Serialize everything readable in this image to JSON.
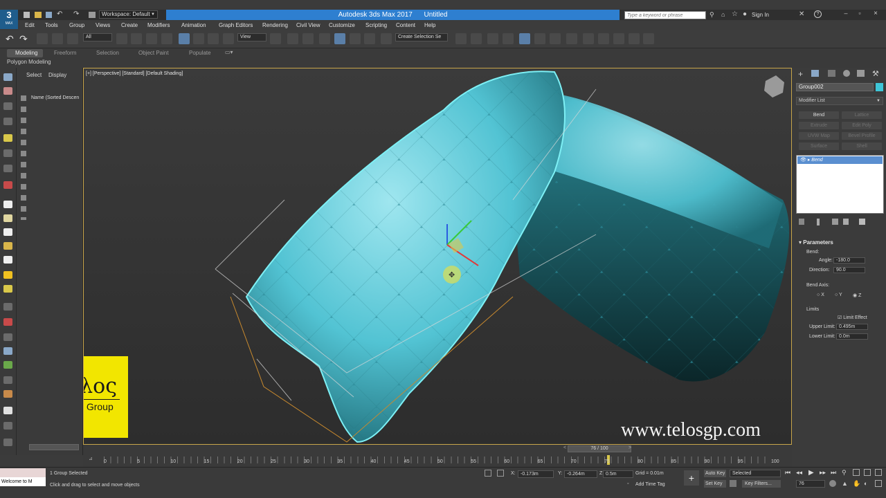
{
  "app": {
    "title": "Autodesk 3ds Max 2017",
    "document": "Untitled",
    "logo_letter": "3",
    "logo_sub": "MAX",
    "workspace": "Workspace: Default",
    "search_placeholder": "Type a keyword or phrase",
    "sign_in": "Sign In"
  },
  "menu": [
    "Edit",
    "Tools",
    "Group",
    "Views",
    "Create",
    "Modifiers",
    "Animation",
    "Graph Editors",
    "Rendering",
    "Civil View",
    "Customize",
    "Scripting",
    "Content",
    "Help"
  ],
  "toolbar": {
    "filter": "All",
    "ref_coord": "View",
    "selection_set": "Create Selection Se"
  },
  "ribbon": {
    "tabs": [
      "Modeling",
      "Freeform",
      "Selection",
      "Object Paint",
      "Populate"
    ],
    "sublabel": "Polygon Modeling"
  },
  "scene_explorer": {
    "tabs": [
      "Select",
      "Display"
    ],
    "column": "Name (Sorted Descen"
  },
  "viewport": {
    "label": "[+] [Perspective] [Standard] [Default Shading]",
    "watermark_url": "www.telosgp.com",
    "logo_greek": "τέλος",
    "logo_name": "Telos Group"
  },
  "command_panel": {
    "object_name": "Group002",
    "modifier_list": "Modifier List",
    "modifier_buttons": [
      "Bend",
      "Lattice",
      "Extrude",
      "Edit Poly",
      "UVW Map",
      "Bevel Profile",
      "Surface",
      "Shell"
    ],
    "stack_item": "Bend",
    "params_title": "Parameters",
    "bend_label": "Bend:",
    "angle_label": "Angle:",
    "angle_value": "-180.0",
    "direction_label": "Direction:",
    "direction_value": "90.0",
    "bend_axis_label": "Bend Axis:",
    "axes": [
      "X",
      "Y",
      "Z"
    ],
    "limits_label": "Limits",
    "limit_effect": "Limit Effect",
    "upper_label": "Upper Limit:",
    "upper_value": "0.495m",
    "lower_label": "Lower Limit:",
    "lower_value": "0.0m"
  },
  "timeline": {
    "frame_display": "76 / 100",
    "current_frame": 76,
    "ticks": [
      "0",
      "5",
      "10",
      "15",
      "20",
      "25",
      "30",
      "35",
      "40",
      "45",
      "50",
      "55",
      "60",
      "65",
      "70",
      "75",
      "80",
      "85",
      "90",
      "95",
      "100"
    ]
  },
  "status": {
    "script_prompt": "Welcome to M",
    "selection_info": "1 Group Selected",
    "hint": "Click and drag to select and move objects",
    "x_label": "X:",
    "x_value": "-0.173m",
    "y_label": "Y:",
    "y_value": "-0.264m",
    "z_label": "Z:",
    "z_value": "0.5m",
    "grid": "Grid = 0.01m",
    "add_time_tag": "Add Time Tag",
    "auto_key": "Auto Key",
    "set_key": "Set Key",
    "selected": "Selected",
    "key_filters": "Key Filters...",
    "frame_field": "76"
  }
}
